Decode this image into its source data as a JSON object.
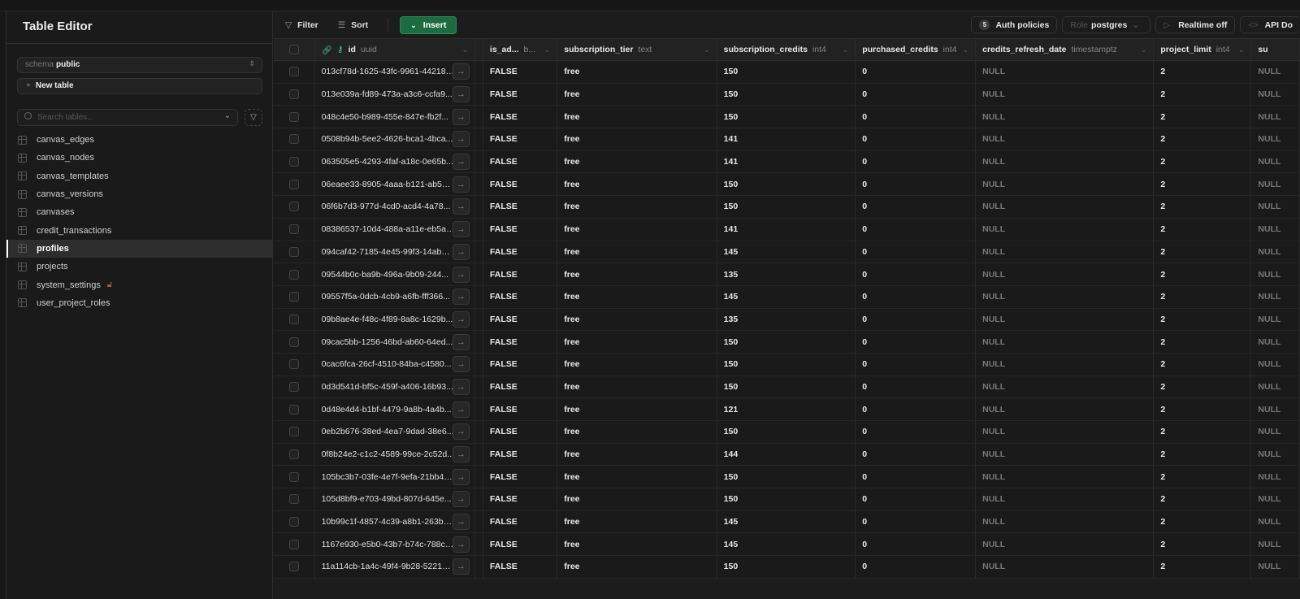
{
  "sidebar": {
    "title": "Table Editor",
    "schema_label": "schema",
    "schema_value": "public",
    "new_table": "New table",
    "search_placeholder": "Search tables...",
    "tables": [
      {
        "name": "canvas_edges"
      },
      {
        "name": "canvas_nodes"
      },
      {
        "name": "canvas_templates"
      },
      {
        "name": "canvas_versions"
      },
      {
        "name": "canvases"
      },
      {
        "name": "credit_transactions"
      },
      {
        "name": "profiles",
        "active": true
      },
      {
        "name": "projects"
      },
      {
        "name": "system_settings",
        "locked": true
      },
      {
        "name": "user_project_roles"
      }
    ]
  },
  "toolbar": {
    "filter": "Filter",
    "sort": "Sort",
    "insert": "Insert",
    "auth_count": "5",
    "auth": "Auth policies",
    "role_label": "Role",
    "role_value": "postgres",
    "realtime": "Realtime off",
    "api_docs": "API Do"
  },
  "columns": [
    {
      "name": "id",
      "type": "uuid"
    },
    {
      "name": "is_ad...",
      "type": "b..."
    },
    {
      "name": "subscription_tier",
      "type": "text"
    },
    {
      "name": "subscription_credits",
      "type": "int4"
    },
    {
      "name": "purchased_credits",
      "type": "int4"
    },
    {
      "name": "credits_refresh_date",
      "type": "timestamptz"
    },
    {
      "name": "project_limit",
      "type": "int4"
    },
    {
      "name": "su",
      "type": ""
    }
  ],
  "rows": [
    [
      "013cf78d-1625-43fc-9961-442189...",
      "FALSE",
      "free",
      "150",
      "0",
      "NULL",
      "2",
      "NULL"
    ],
    [
      "013e039a-fd89-473a-a3c6-ccfa9...",
      "FALSE",
      "free",
      "150",
      "0",
      "NULL",
      "2",
      "NULL"
    ],
    [
      "048c4e50-b989-455e-847e-fb2f...",
      "FALSE",
      "free",
      "150",
      "0",
      "NULL",
      "2",
      "NULL"
    ],
    [
      "0508b94b-5ee2-4626-bca1-4bca...",
      "FALSE",
      "free",
      "141",
      "0",
      "NULL",
      "2",
      "NULL"
    ],
    [
      "063505e5-4293-4faf-a18c-0e65b...",
      "FALSE",
      "free",
      "141",
      "0",
      "NULL",
      "2",
      "NULL"
    ],
    [
      "06eaee33-8905-4aaa-b121-ab552...",
      "FALSE",
      "free",
      "150",
      "0",
      "NULL",
      "2",
      "NULL"
    ],
    [
      "06f6b7d3-977d-4cd0-acd4-4a78...",
      "FALSE",
      "free",
      "150",
      "0",
      "NULL",
      "2",
      "NULL"
    ],
    [
      "08386537-10d4-488a-a11e-eb5a6...",
      "FALSE",
      "free",
      "141",
      "0",
      "NULL",
      "2",
      "NULL"
    ],
    [
      "094caf42-7185-4e45-99f3-14abee...",
      "FALSE",
      "free",
      "145",
      "0",
      "NULL",
      "2",
      "NULL"
    ],
    [
      "09544b0c-ba9b-496a-9b09-244...",
      "FALSE",
      "free",
      "135",
      "0",
      "NULL",
      "2",
      "NULL"
    ],
    [
      "09557f5a-0dcb-4cb9-a6fb-fff366...",
      "FALSE",
      "free",
      "145",
      "0",
      "NULL",
      "2",
      "NULL"
    ],
    [
      "09b8ae4e-f48c-4f89-8a8c-1629b...",
      "FALSE",
      "free",
      "135",
      "0",
      "NULL",
      "2",
      "NULL"
    ],
    [
      "09cac5bb-1256-46bd-ab60-64ed...",
      "FALSE",
      "free",
      "150",
      "0",
      "NULL",
      "2",
      "NULL"
    ],
    [
      "0cac6fca-26cf-4510-84ba-c4580...",
      "FALSE",
      "free",
      "150",
      "0",
      "NULL",
      "2",
      "NULL"
    ],
    [
      "0d3d541d-bf5c-459f-a406-16b93...",
      "FALSE",
      "free",
      "150",
      "0",
      "NULL",
      "2",
      "NULL"
    ],
    [
      "0d48e4d4-b1bf-4479-9a8b-4a4b...",
      "FALSE",
      "free",
      "121",
      "0",
      "NULL",
      "2",
      "NULL"
    ],
    [
      "0eb2b676-38ed-4ea7-9dad-38e6...",
      "FALSE",
      "free",
      "150",
      "0",
      "NULL",
      "2",
      "NULL"
    ],
    [
      "0f8b24e2-c1c2-4589-99ce-2c52d...",
      "FALSE",
      "free",
      "144",
      "0",
      "NULL",
      "2",
      "NULL"
    ],
    [
      "105bc3b7-03fe-4e7f-9efa-21bb40...",
      "FALSE",
      "free",
      "150",
      "0",
      "NULL",
      "2",
      "NULL"
    ],
    [
      "105d8bf9-e703-49bd-807d-645e...",
      "FALSE",
      "free",
      "150",
      "0",
      "NULL",
      "2",
      "NULL"
    ],
    [
      "10b99c1f-4857-4c39-a8b1-263b8...",
      "FALSE",
      "free",
      "145",
      "0",
      "NULL",
      "2",
      "NULL"
    ],
    [
      "1167e930-e5b0-43b7-b74c-788c9...",
      "FALSE",
      "free",
      "145",
      "0",
      "NULL",
      "2",
      "NULL"
    ],
    [
      "11a114cb-1a4c-49f4-9b28-52219ec...",
      "FALSE",
      "free",
      "150",
      "0",
      "NULL",
      "2",
      "NULL"
    ]
  ]
}
